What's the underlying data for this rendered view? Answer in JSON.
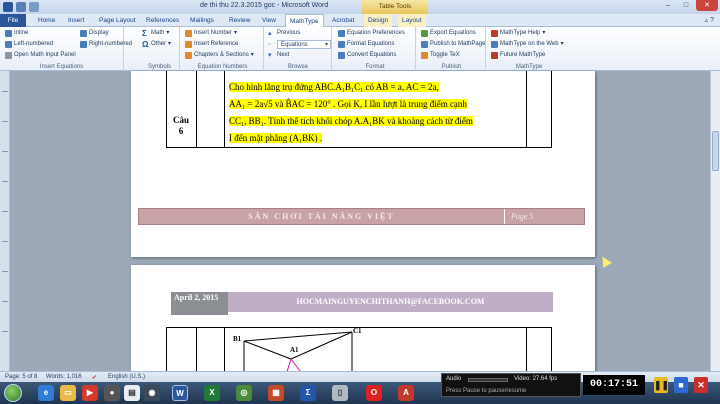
{
  "window": {
    "title": "de thi thu 22.3.2015 goc - Microsoft Word",
    "context_tab_group": "Table Tools",
    "minimize": "–",
    "maximize": "□",
    "close": "✕"
  },
  "tabs": [
    "File",
    "Home",
    "Insert",
    "Page Layout",
    "References",
    "Mailings",
    "Review",
    "View",
    "MathType",
    "Acrobat",
    "Design",
    "Layout"
  ],
  "active_tab": "MathType",
  "ribbon": {
    "insert_equations": {
      "label": "Insert Equations",
      "items": [
        "Inline",
        "Display",
        "Left-numbered",
        "Right-numbered",
        "Open Math Input Panel"
      ]
    },
    "symbols": {
      "label": "Symbols",
      "items": [
        "Math",
        "Other"
      ]
    },
    "equation_numbers": {
      "label": "Equation Numbers",
      "items": [
        "Insert Number",
        "Insert Reference",
        "Chapters & Sections"
      ]
    },
    "browse": {
      "label": "Browse",
      "items": [
        "Previous",
        "Equations",
        "Next"
      ]
    },
    "format": {
      "label": "Format",
      "items": [
        "Equation Preferences",
        "Format Equations",
        "Convert Equations"
      ]
    },
    "publish": {
      "label": "Publish",
      "items": [
        "Export Equations",
        "Publish to MathPage",
        "Toggle TeX"
      ]
    },
    "mathtype": {
      "label": "MathType",
      "items": [
        "MathType Help",
        "MathType on the Web",
        "Future MathType"
      ]
    }
  },
  "document": {
    "page1": {
      "cau_label": "Câu",
      "cau_number": "6",
      "problem_lines": [
        "Cho  hình  lăng  trụ  đứng   ABC.A₁B₁C₁   có   AB = a,  AC = 2a,",
        "AA₁ = 2a√5  và  B̂AC = 120°  . Gọi K, I lần lượt là trung điểm cạnh",
        "CC₁, BB₁. Tính thể tích khối chóp  A.A₁BK  và khoảng cách từ điểm",
        "I đến mặt phẳng (A₁BK) ."
      ],
      "footer_text": "SÂN CHƠI TÀI NĂNG VIỆT",
      "footer_page": "Page 5"
    },
    "page2": {
      "header_date": "April 2, 2015",
      "header_email": "HOCMAINGUYENCHITHANH@FACEBOOK.COM",
      "figure_labels": [
        "B1",
        "C1",
        "A1"
      ]
    }
  },
  "statusbar": {
    "page": "Page: 5 of 8",
    "words": "Words: 1,016",
    "language": "English (U.S.)"
  },
  "recorder": {
    "audio_label": "Audio",
    "video_label": "Video: 27.64 fps",
    "hint": "Press Pause to pause/resume",
    "time": "00:17:51"
  },
  "colors": {
    "file_tab": "#2b579a",
    "highlight": "#ffff00",
    "footer_bar": "#c8a2a5",
    "header_mail": "#bfaec5"
  }
}
